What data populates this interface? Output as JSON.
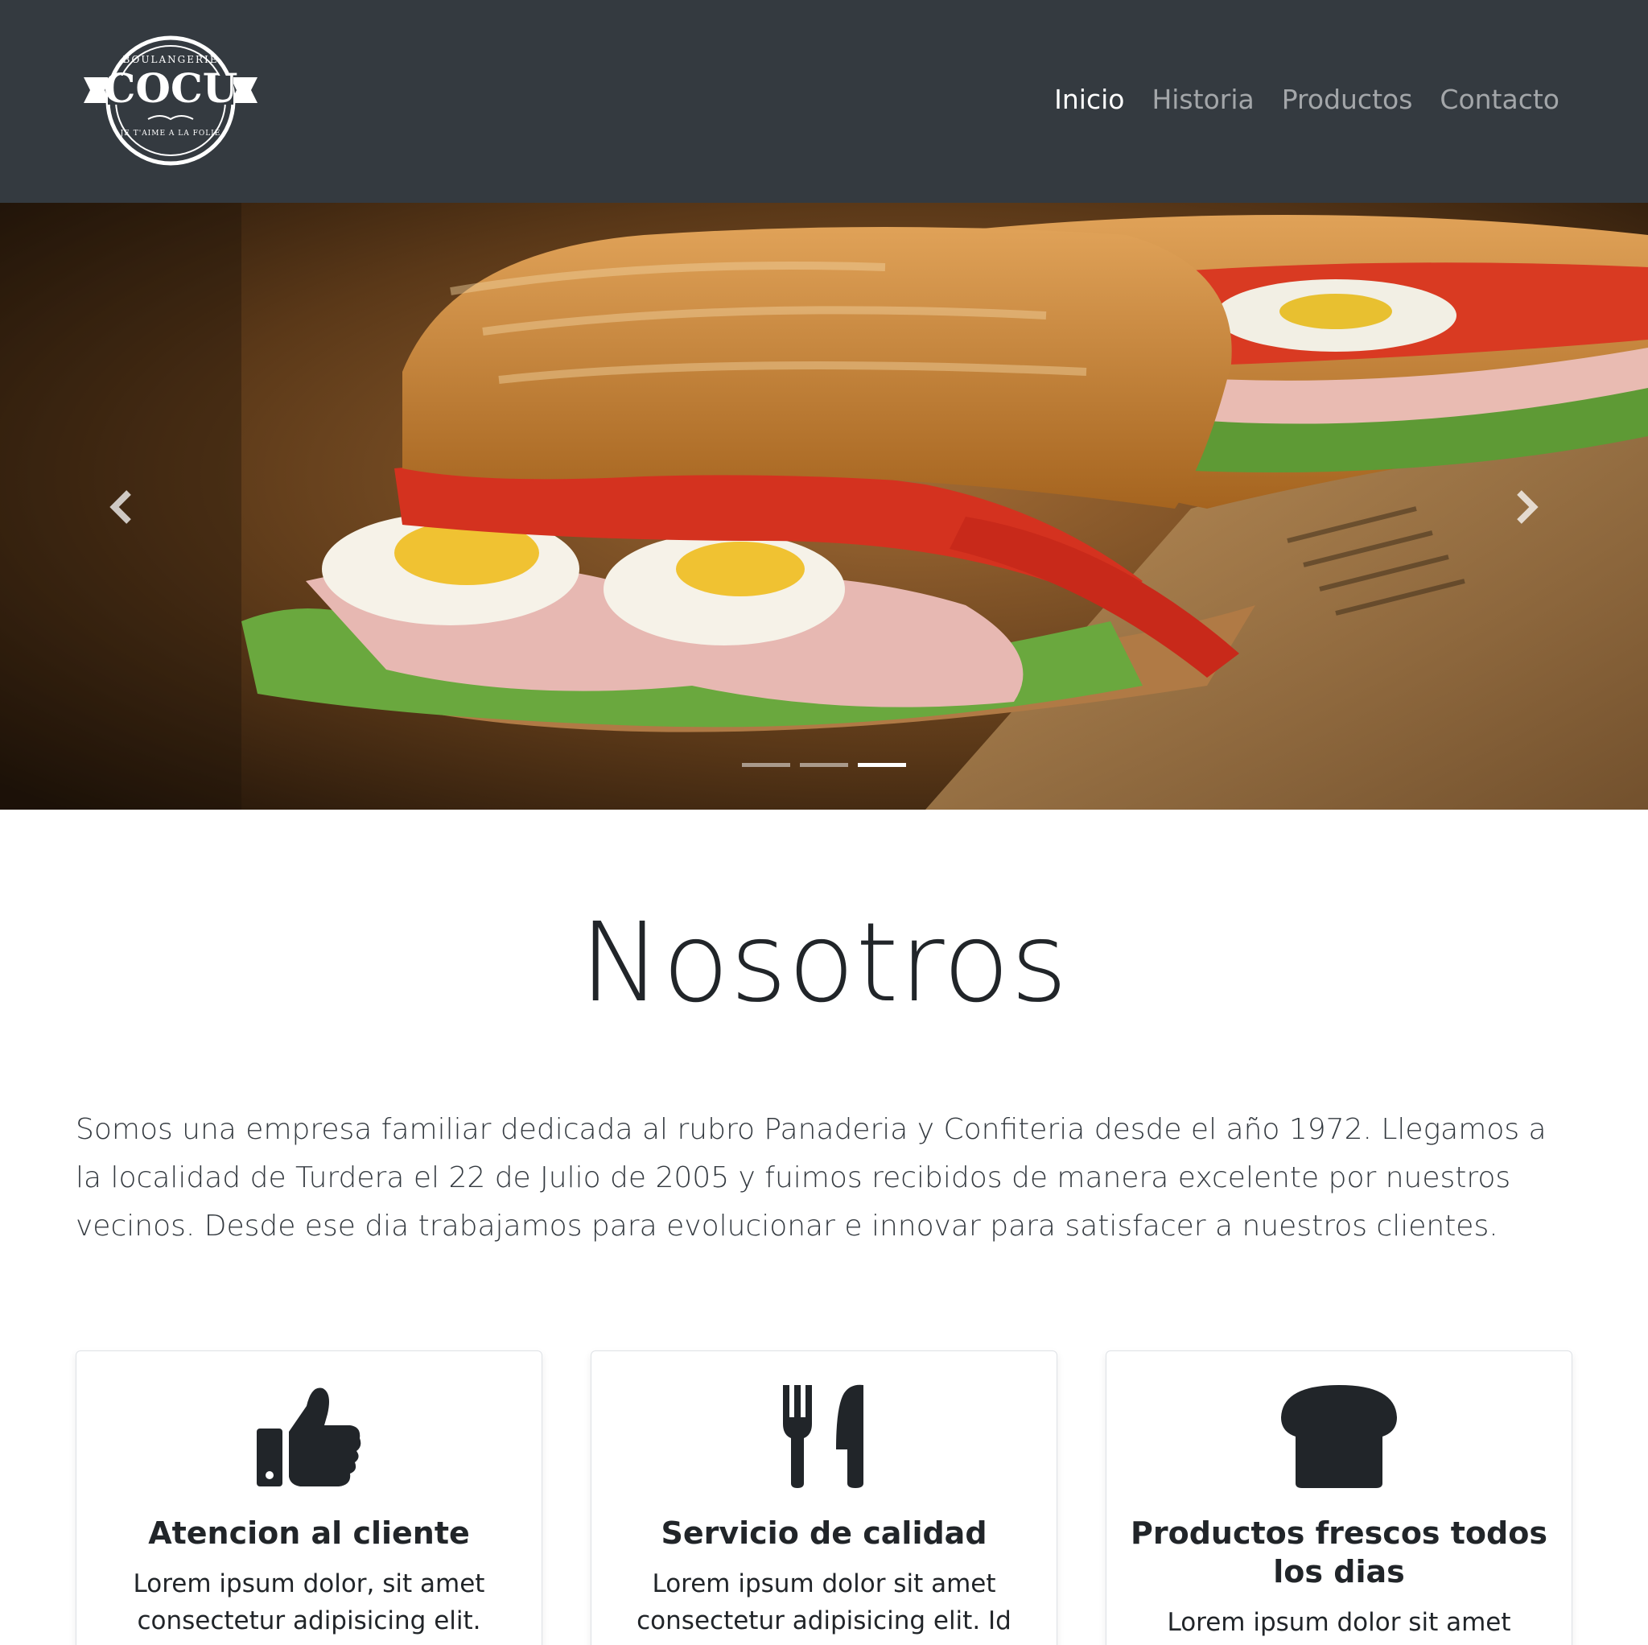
{
  "brand": {
    "logo_top_text": "BOULANGERIE",
    "logo_main_text": "COCU",
    "logo_bottom_text": "JE T'AIME A LA FOLIE"
  },
  "nav": {
    "items": [
      {
        "label": "Inicio",
        "active": true
      },
      {
        "label": "Historia",
        "active": false
      },
      {
        "label": "Productos",
        "active": false
      },
      {
        "label": "Contacto",
        "active": false
      }
    ]
  },
  "carousel": {
    "slides_count": 3,
    "active_slide": 3,
    "prev_icon": "chevron-left-icon",
    "next_icon": "chevron-right-icon"
  },
  "about": {
    "title": "Nosotros",
    "text": "Somos una empresa familiar dedicada al rubro Panaderia y Confiteria desde el año 1972. Llegamos a la localidad de Turdera el 22 de Julio de 2005 y fuimos recibidos de manera excelente por nuestros vecinos. Desde ese dia trabajamos para evolucionar e innovar para satisfacer a nuestros clientes."
  },
  "cards": [
    {
      "icon": "thumbs-up-icon",
      "title": "Atencion al cliente",
      "text": "Lorem ipsum dolor, sit amet consectetur adipisicing elit. Error"
    },
    {
      "icon": "utensils-icon",
      "title": "Servicio de calidad",
      "text": "Lorem ipsum dolor sit amet consectetur adipisicing elit. Id vitae"
    },
    {
      "icon": "bread-icon",
      "title": "Productos frescos todos los dias",
      "text": "Lorem ipsum dolor sit amet"
    }
  ],
  "colors": {
    "navbar": "#343a40",
    "nav_link": "rgba(255,255,255,0.55)",
    "nav_link_active": "#ffffff",
    "text": "#212529"
  }
}
